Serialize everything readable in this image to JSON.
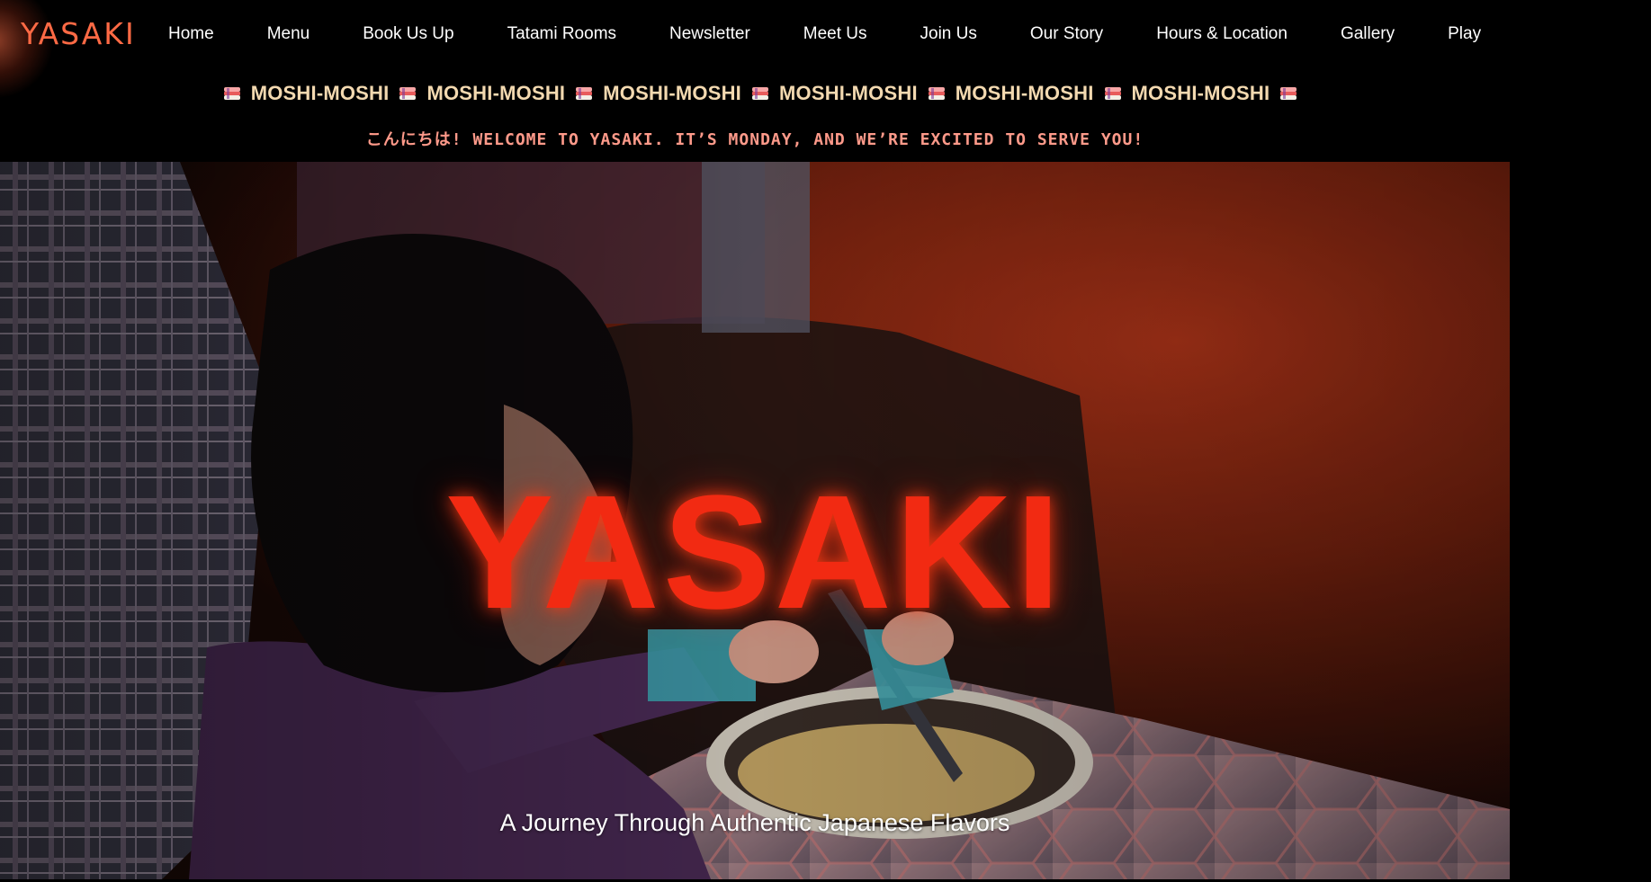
{
  "brand": {
    "logo_text": "YASAKI",
    "accent_color": "#ff6a45",
    "hero_title_color": "#f22a12"
  },
  "nav": {
    "items": [
      {
        "label": "Home"
      },
      {
        "label": "Menu"
      },
      {
        "label": "Book Us Up"
      },
      {
        "label": "Tatami Rooms"
      },
      {
        "label": "Newsletter"
      },
      {
        "label": "Meet Us"
      },
      {
        "label": "Join Us"
      },
      {
        "label": "Our Story"
      },
      {
        "label": "Hours & Location"
      },
      {
        "label": "Gallery"
      },
      {
        "label": "Play"
      }
    ]
  },
  "ticker": {
    "icon": "sushi-icon",
    "items": [
      "MOSHI-MOSHI",
      "MOSHI-MOSHI",
      "MOSHI-MOSHI",
      "MOSHI-MOSHI",
      "MOSHI-MOSHI",
      "MOSHI-MOSHI"
    ]
  },
  "welcome": {
    "text": "こんにちは! WELCOME TO YASAKI. IT’S MONDAY, AND WE’RE EXCITED TO SERVE YOU!"
  },
  "hero": {
    "title": "YASAKI",
    "tagline": "A Journey Through Authentic Japanese Flavors"
  }
}
